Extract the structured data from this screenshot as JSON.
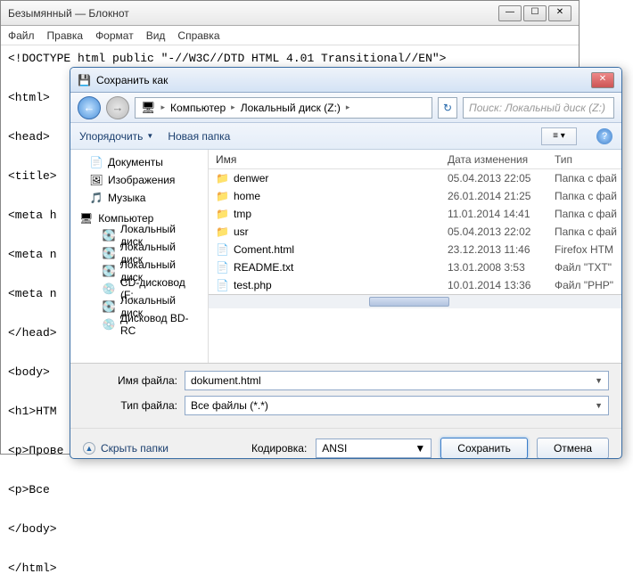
{
  "notepad": {
    "title": "Безымянный — Блокнот",
    "menu": [
      "Файл",
      "Правка",
      "Формат",
      "Вид",
      "Справка"
    ],
    "content": "<!DOCTYPE html public \"-//W3C//DTD HTML 4.01 Transitional//EN\">\n\n<html>\n\n<head>\n\n<title>\n\n<meta h\n\n<meta n\n\n<meta n\n\n</head>\n\n<body>\n\n<h1>HTM\n\n<p>Прове\n\n<p>Все\n\n</body>\n\n</html>"
  },
  "dialog": {
    "title": "Сохранить как",
    "nav": {
      "segments": [
        "Компьютер",
        "Локальный диск (Z:)"
      ],
      "search_placeholder": "Поиск: Локальный диск (Z:)"
    },
    "toolbar": {
      "organize": "Упорядочить",
      "newfolder": "Новая папка"
    },
    "sidebar": {
      "libs": [
        {
          "icon": "📄",
          "label": "Документы"
        },
        {
          "icon": "🖼",
          "label": "Изображения"
        },
        {
          "icon": "🎵",
          "label": "Музыка"
        }
      ],
      "computer_label": "Компьютер",
      "drives": [
        {
          "icon": "💽",
          "label": "Локальный диск"
        },
        {
          "icon": "💽",
          "label": "Локальный диск"
        },
        {
          "icon": "💽",
          "label": "Локальный диск"
        },
        {
          "icon": "💿",
          "label": "CD-дисковод (F:"
        },
        {
          "icon": "💽",
          "label": "Локальный диск"
        },
        {
          "icon": "💿",
          "label": "Дисковод BD-RC"
        }
      ]
    },
    "columns": {
      "name": "Имя",
      "date": "Дата изменения",
      "type": "Тип"
    },
    "files": [
      {
        "icon": "folder",
        "name": "denwer",
        "date": "05.04.2013 22:05",
        "type": "Папка с фай"
      },
      {
        "icon": "folder",
        "name": "home",
        "date": "26.01.2014 21:25",
        "type": "Папка с фай"
      },
      {
        "icon": "folder",
        "name": "tmp",
        "date": "11.01.2014 14:41",
        "type": "Папка с фай"
      },
      {
        "icon": "folder",
        "name": "usr",
        "date": "05.04.2013 22:02",
        "type": "Папка с фай"
      },
      {
        "icon": "file",
        "name": "Coment.html",
        "date": "23.12.2013 11:46",
        "type": "Firefox HTM"
      },
      {
        "icon": "file",
        "name": "README.txt",
        "date": "13.01.2008 3:53",
        "type": "Файл \"TXT\""
      },
      {
        "icon": "file",
        "name": "test.php",
        "date": "10.01.2014 13:36",
        "type": "Файл \"PHP\""
      }
    ],
    "filename_label": "Имя файла:",
    "filename_value": "dokument.html",
    "filetype_label": "Тип файла:",
    "filetype_value": "Все файлы (*.*)",
    "hide_folders": "Скрыть папки",
    "encoding_label": "Кодировка:",
    "encoding_value": "ANSI",
    "save_btn": "Сохранить",
    "cancel_btn": "Отмена"
  }
}
